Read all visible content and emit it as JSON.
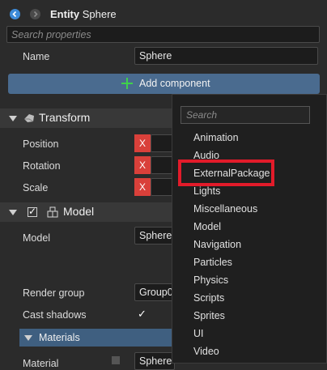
{
  "header": {
    "title_bold": "Entity",
    "title_rest": " Sphere"
  },
  "search": {
    "placeholder": "Search properties"
  },
  "name_row": {
    "label": "Name",
    "value": "Sphere"
  },
  "add_component": {
    "label": "Add component"
  },
  "transform": {
    "title": "Transform",
    "rows": [
      {
        "label": "Position",
        "x": "X"
      },
      {
        "label": "Rotation",
        "x": "X"
      },
      {
        "label": "Scale",
        "x": "X"
      }
    ]
  },
  "model": {
    "title": "Model",
    "model_label": "Model",
    "model_value": "Sphere",
    "render_group_label": "Render group",
    "render_group_value": "Group0",
    "cast_shadows_label": "Cast shadows",
    "cast_shadows_check": "✓",
    "model_enabled_check": "✓"
  },
  "materials": {
    "title": "Materials",
    "material_label": "Material",
    "material_value": "Sphere"
  },
  "dropdown": {
    "search_placeholder": "Search",
    "items": [
      "Animation",
      "Audio",
      "ExternalPackage",
      "Lights",
      "Miscellaneous",
      "Model",
      "Navigation",
      "Particles",
      "Physics",
      "Scripts",
      "Sprites",
      "UI",
      "Video"
    ],
    "highlighted": "ExternalPackage"
  },
  "colors": {
    "accent": "#4a6b8f",
    "remove": "#d9403a",
    "highlight": "#e21b2a"
  }
}
